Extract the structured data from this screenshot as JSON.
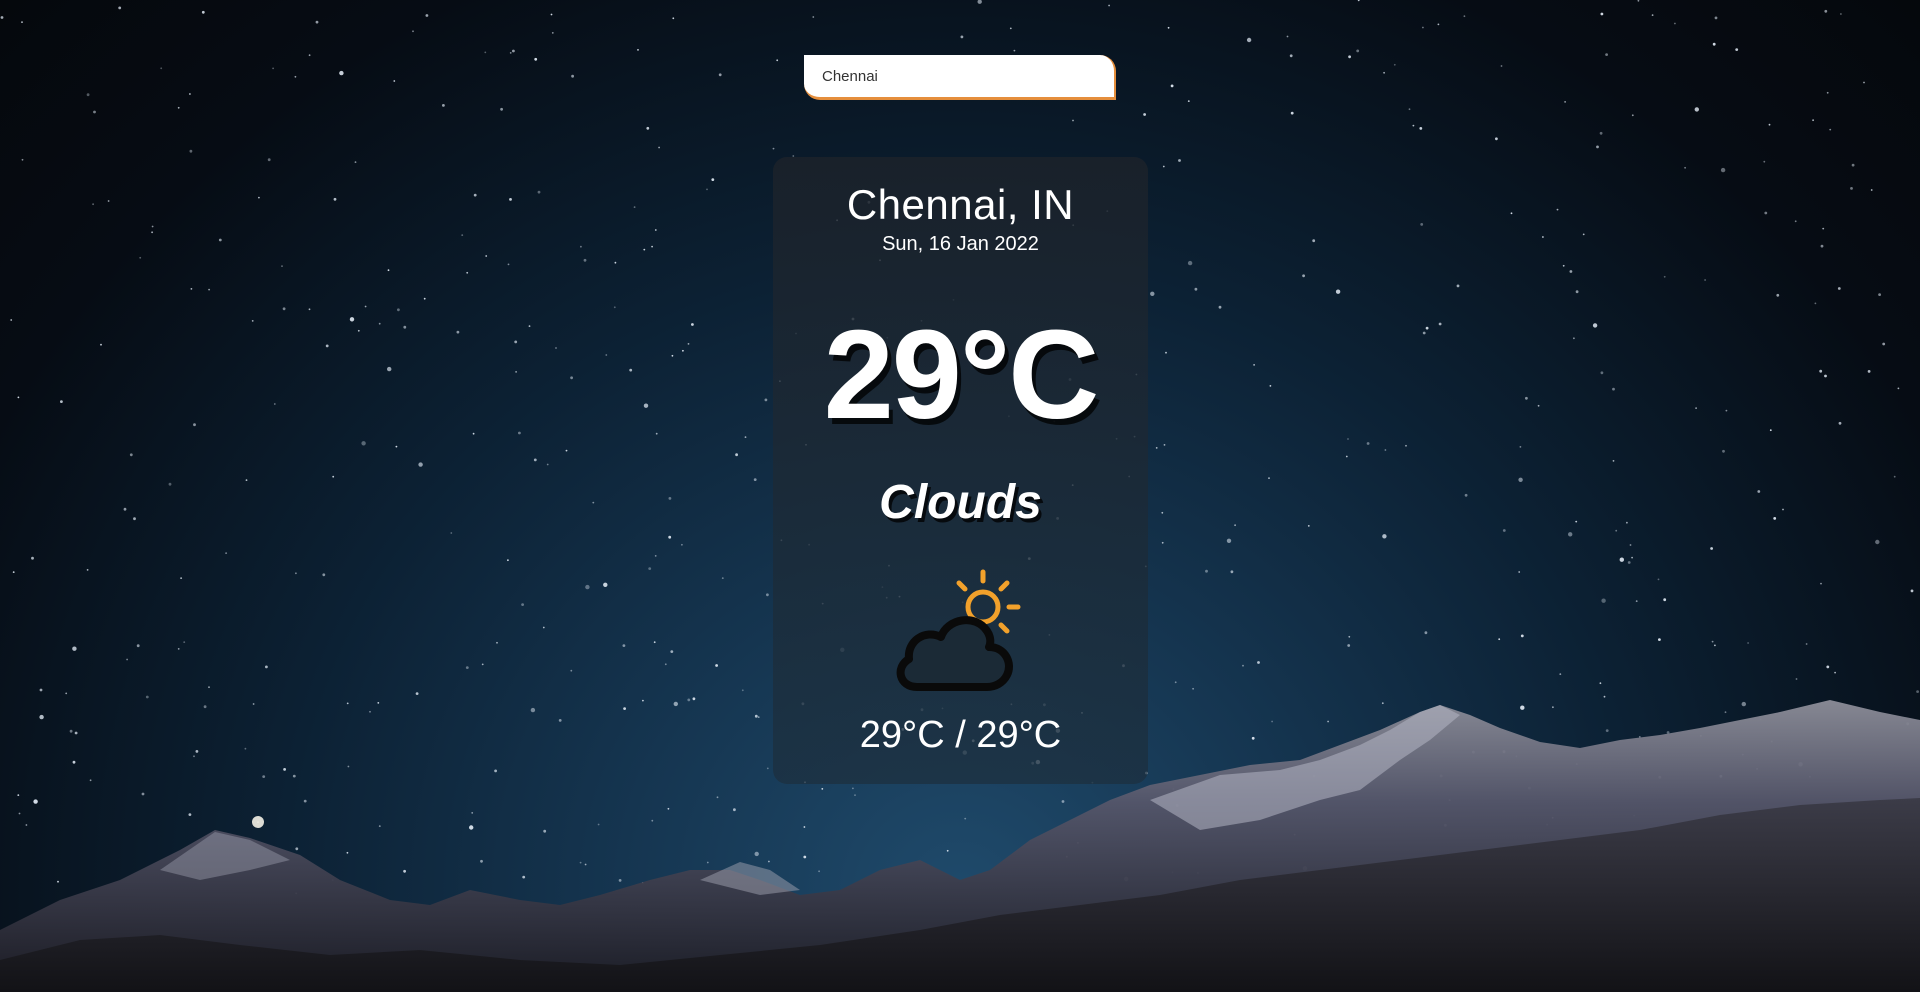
{
  "search": {
    "value": "Chennai",
    "placeholder": ""
  },
  "weather": {
    "location": "Chennai, IN",
    "date": "Sun, 16 Jan 2022",
    "temperature": "29°C",
    "condition": "Clouds",
    "icon": "partly-cloudy-icon",
    "hi_lo": "29°C / 29°C"
  },
  "colors": {
    "accent": "#e58e3c",
    "sun": "#f2a12b",
    "cloud_outline": "#0a0a0a"
  }
}
